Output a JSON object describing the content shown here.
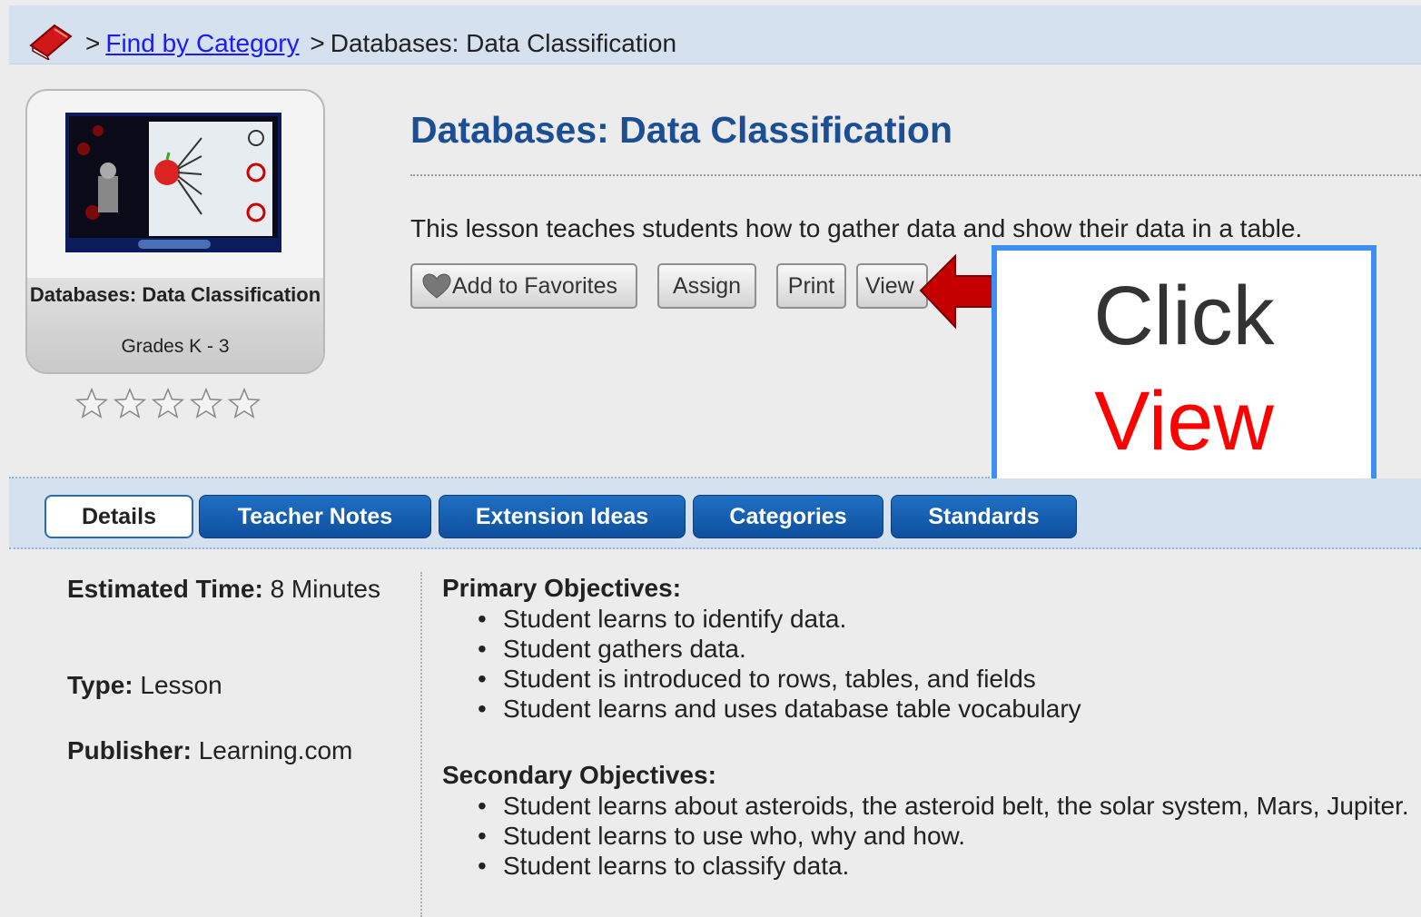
{
  "breadcrumb": {
    "separator": ">",
    "link_label": "Find by Category",
    "current": "Databases: Data Classification"
  },
  "card": {
    "title": "Databases: Data Classification",
    "grades": "Grades K - 3",
    "rating_stars": 5,
    "rating_filled": 0
  },
  "lesson": {
    "title": "Databases: Data Classification",
    "description": "This lesson teaches students how to gather data and show their data in a table."
  },
  "actions": {
    "favorites": "Add to Favorites",
    "assign": "Assign",
    "print": "Print",
    "view": "View"
  },
  "callout": {
    "line1": "Click",
    "line2": "View"
  },
  "tabs": [
    {
      "label": "Details",
      "active": true
    },
    {
      "label": "Teacher Notes",
      "active": false
    },
    {
      "label": "Extension Ideas",
      "active": false
    },
    {
      "label": "Categories",
      "active": false
    },
    {
      "label": "Standards",
      "active": false
    }
  ],
  "details": {
    "time_label": "Estimated Time:",
    "time_value": "8 Minutes",
    "type_label": "Type:",
    "type_value": "Lesson",
    "publisher_label": "Publisher:",
    "publisher_value": "Learning.com"
  },
  "objectives": {
    "primary_heading": "Primary Objectives:",
    "primary": [
      "Student learns to identify data.",
      "Student gathers data.",
      "Student is introduced to rows, tables, and fields",
      "Student learns and uses database table vocabulary"
    ],
    "secondary_heading": "Secondary Objectives:",
    "secondary": [
      "Student learns about asteroids, the asteroid belt, the solar system, Mars, Jupiter.",
      "Student learns to use who, why and how.",
      "Student learns to classify data."
    ]
  },
  "colors": {
    "title_blue": "#1c4e93",
    "tab_blue": "#1f70c4",
    "callout_border": "#3d8ff0",
    "callout_red": "#ff0000",
    "link": "#1a1aff"
  }
}
